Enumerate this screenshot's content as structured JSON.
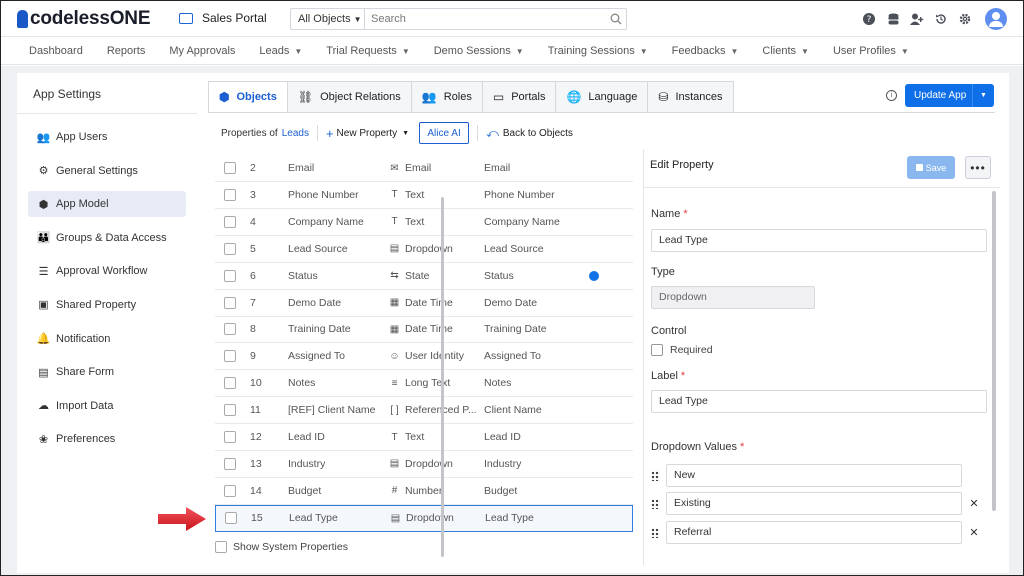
{
  "app": {
    "brand": "codelessONE",
    "portal_name": "Sales Portal"
  },
  "search": {
    "scope": "All Objects",
    "placeholder": "Search"
  },
  "nav": [
    "Dashboard",
    "Reports",
    "My Approvals",
    "Leads",
    "Trial Requests",
    "Demo Sessions",
    "Training Sessions",
    "Feedbacks",
    "Clients",
    "User Profiles"
  ],
  "nav_dropdowns": [
    false,
    false,
    false,
    true,
    true,
    true,
    true,
    true,
    true,
    true
  ],
  "sidebar": {
    "title": "App Settings",
    "items": [
      {
        "label": "App Users",
        "icon": "users-icon"
      },
      {
        "label": "General Settings",
        "icon": "gear-icon"
      },
      {
        "label": "App Model",
        "icon": "cube-icon",
        "active": true
      },
      {
        "label": "Groups & Data Access",
        "icon": "group-icon"
      },
      {
        "label": "Approval Workflow",
        "icon": "checklist-icon"
      },
      {
        "label": "Shared Property",
        "icon": "shared-property-icon"
      },
      {
        "label": "Notification",
        "icon": "bell-icon"
      },
      {
        "label": "Share Form",
        "icon": "form-icon"
      },
      {
        "label": "Import Data",
        "icon": "cloud-upload-icon"
      },
      {
        "label": "Preferences",
        "icon": "preferences-icon"
      }
    ]
  },
  "tabs": [
    {
      "label": "Objects",
      "icon": "cube-icon",
      "active": true
    },
    {
      "label": "Object Relations",
      "icon": "relations-icon"
    },
    {
      "label": "Roles",
      "icon": "roles-icon"
    },
    {
      "label": "Portals",
      "icon": "monitor-icon"
    },
    {
      "label": "Language",
      "icon": "globe-icon"
    },
    {
      "label": "Instances",
      "icon": "database-icon"
    }
  ],
  "actions": {
    "update_app": "Update App"
  },
  "toolbar": {
    "properties_of": "Properties of",
    "object_name": "Leads",
    "new_property": "New Property",
    "alice_ai": "Alice AI",
    "back_to_objects": "Back to Objects"
  },
  "properties": [
    {
      "num": "2",
      "name": "Email",
      "type": "Email",
      "type_icon": "envelope-icon",
      "label": "Email"
    },
    {
      "num": "3",
      "name": "Phone Number",
      "type": "Text",
      "type_icon": "text-icon",
      "label": "Phone Number"
    },
    {
      "num": "4",
      "name": "Company Name",
      "type": "Text",
      "type_icon": "text-icon",
      "label": "Company Name"
    },
    {
      "num": "5",
      "name": "Lead Source",
      "type": "Dropdown",
      "type_icon": "dropdown-icon",
      "label": "Lead Source"
    },
    {
      "num": "6",
      "name": "Status",
      "type": "State",
      "type_icon": "state-icon",
      "label": "Status",
      "indicator": true
    },
    {
      "num": "7",
      "name": "Demo Date",
      "type": "Date Time",
      "type_icon": "calendar-icon",
      "label": "Demo Date"
    },
    {
      "num": "8",
      "name": "Training Date",
      "type": "Date Time",
      "type_icon": "calendar-icon",
      "label": "Training Date"
    },
    {
      "num": "9",
      "name": "Assigned To",
      "type": "User Identity",
      "type_icon": "user-icon",
      "label": "Assigned To"
    },
    {
      "num": "10",
      "name": "Notes",
      "type": "Long Text",
      "type_icon": "long-text-icon",
      "label": "Notes"
    },
    {
      "num": "11",
      "name": "[REF] Client Name",
      "type": "Referenced P...",
      "type_icon": "brackets-icon",
      "label": "Client Name"
    },
    {
      "num": "12",
      "name": "Lead ID",
      "type": "Text",
      "type_icon": "text-icon",
      "label": "Lead ID"
    },
    {
      "num": "13",
      "name": "Industry",
      "type": "Dropdown",
      "type_icon": "dropdown-icon",
      "label": "Industry"
    },
    {
      "num": "14",
      "name": "Budget",
      "type": "Number",
      "type_icon": "hash-icon",
      "label": "Budget"
    },
    {
      "num": "15",
      "name": "Lead Type",
      "type": "Dropdown",
      "type_icon": "dropdown-icon",
      "label": "Lead Type",
      "selected": true
    }
  ],
  "show_system_properties": "Show System Properties",
  "edit": {
    "title": "Edit Property",
    "save": "Save",
    "name_label": "Name",
    "name_value": "Lead Type",
    "type_label": "Type",
    "type_value": "Dropdown",
    "control_label": "Control",
    "required_label": "Required",
    "label_label": "Label",
    "label_value": "Lead Type",
    "dropdown_values_label": "Dropdown Values",
    "dropdown_values": [
      "New",
      "Existing",
      "Referral"
    ]
  },
  "colors": {
    "primary": "#0f6fe8",
    "accent_link": "#1b5fd1",
    "required": "#e23b3b",
    "arrow": "#e8212b"
  }
}
